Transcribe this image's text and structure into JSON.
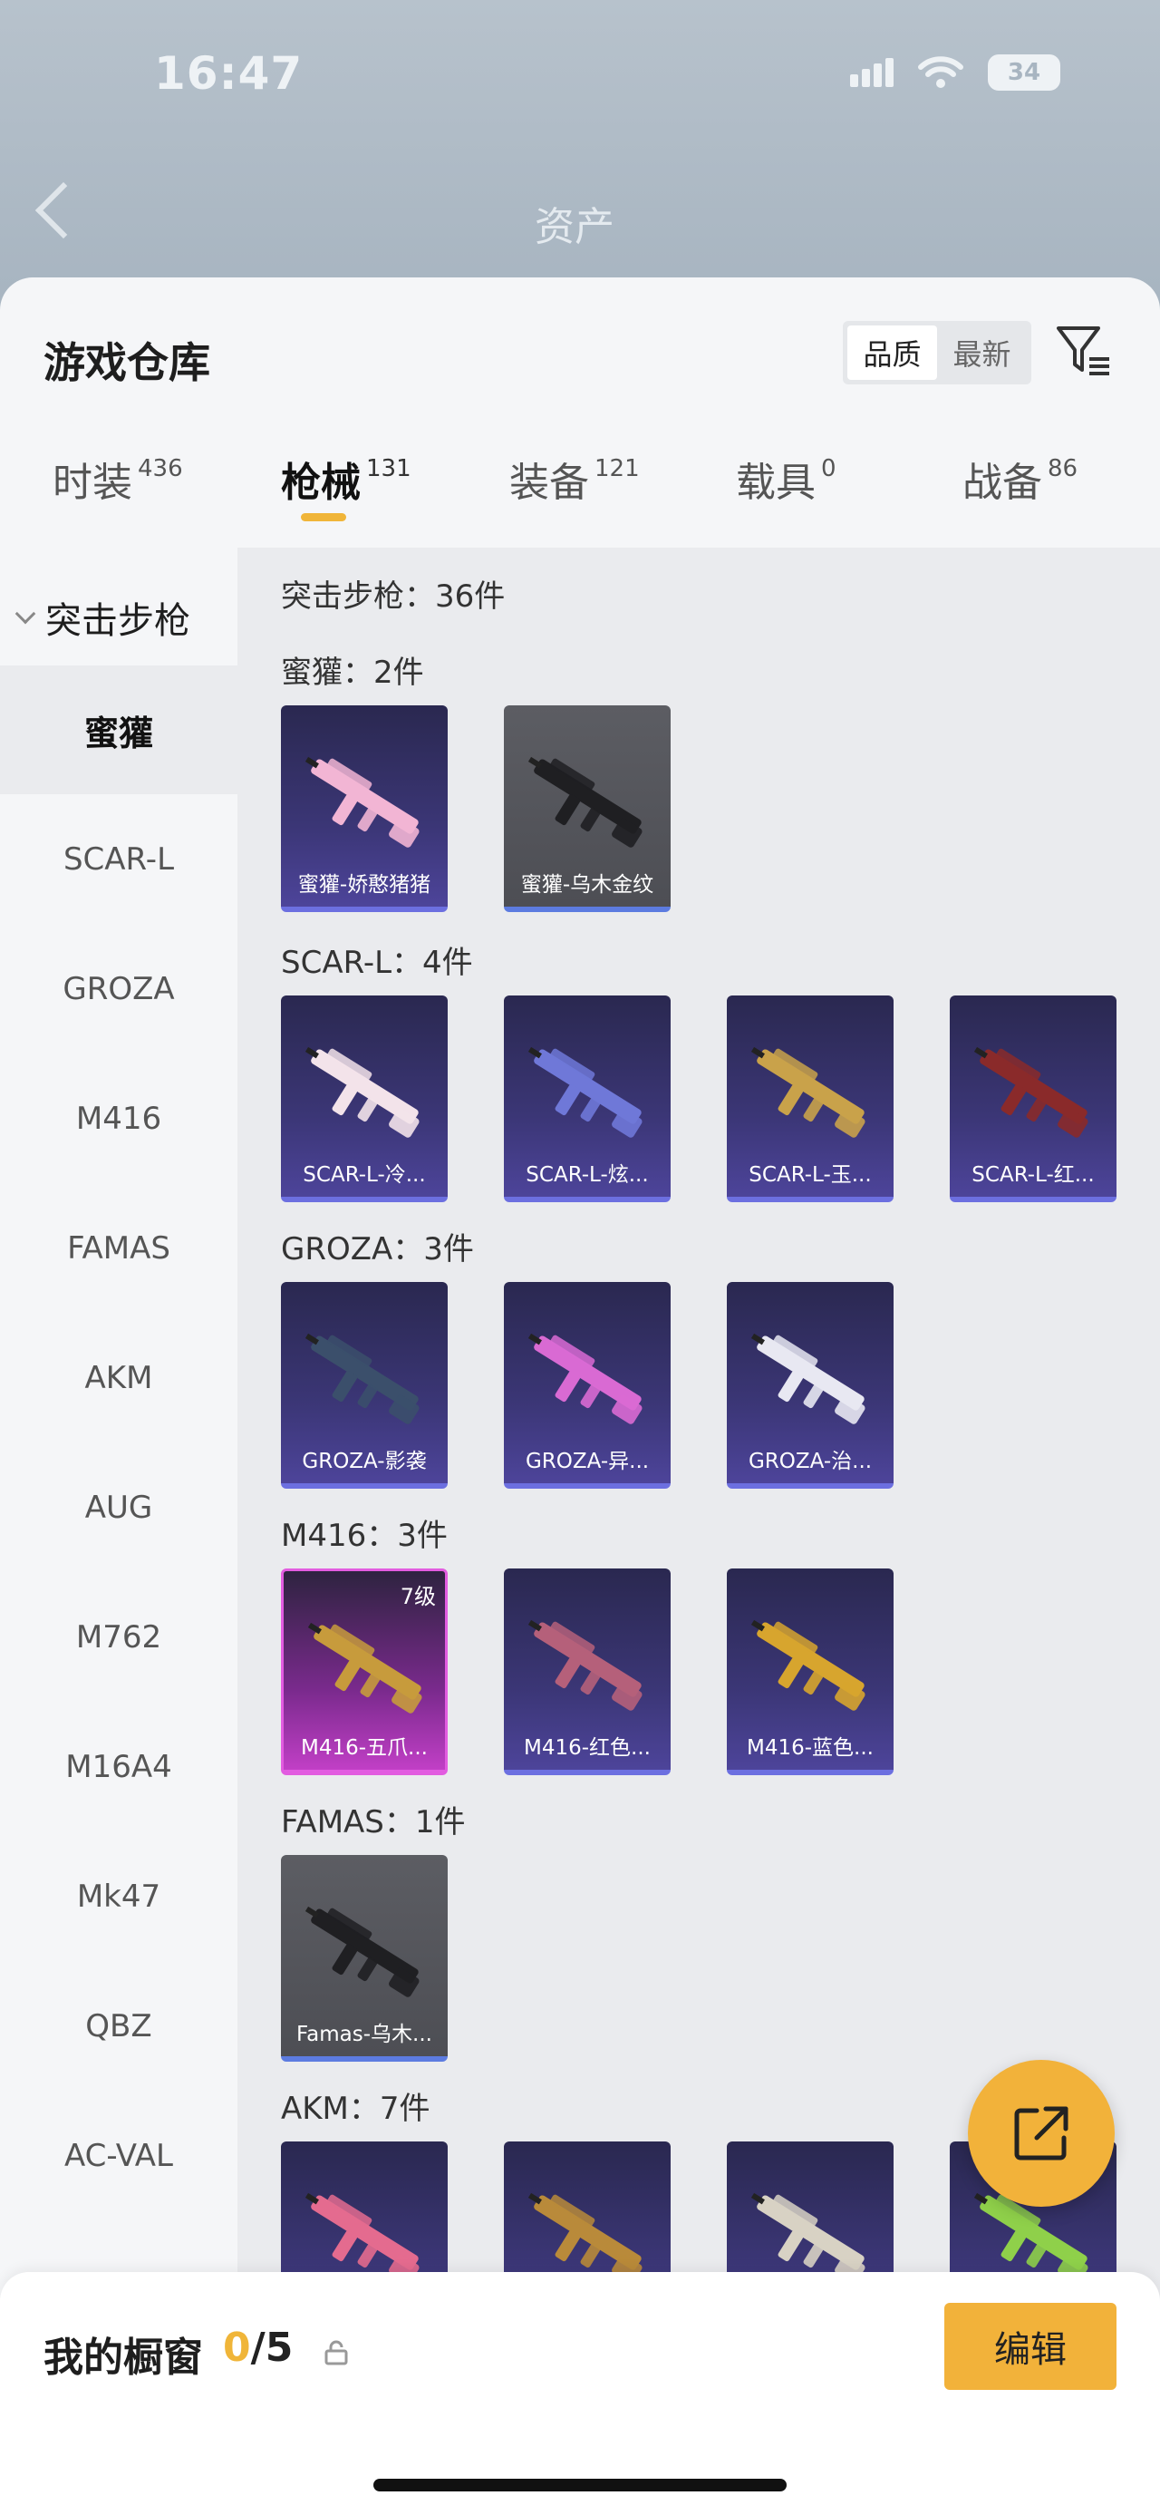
{
  "status_bar": {
    "time": "16:47",
    "battery": "34"
  },
  "nav": {
    "title": "资产"
  },
  "sheet": {
    "title": "游戏仓库",
    "sort_options": [
      "品质",
      "最新"
    ],
    "sort_active": "品质"
  },
  "tabs": [
    {
      "label": "时装",
      "count": "436"
    },
    {
      "label": "枪械",
      "count": "131"
    },
    {
      "label": "装备",
      "count": "121"
    },
    {
      "label": "载具",
      "count": "0"
    },
    {
      "label": "战备",
      "count": "86"
    }
  ],
  "sidebar": {
    "heading": "突击步枪",
    "items": [
      "蜜獾",
      "SCAR-L",
      "GROZA",
      "M416",
      "FAMAS",
      "AKM",
      "AUG",
      "M762",
      "M16A4",
      "Mk47",
      "QBZ",
      "AC-VAL"
    ],
    "active": "蜜獾"
  },
  "content": {
    "summary": "突击步枪：36件",
    "groups": [
      {
        "label": "蜜獾：2件",
        "items": [
          {
            "name": "蜜獾-娇憨猪猪",
            "style": "purple",
            "gun_color": "#f2b5d4"
          },
          {
            "name": "蜜獾-乌木金纹",
            "style": "grey",
            "gun_color": "#1f1f22"
          }
        ]
      },
      {
        "label": "SCAR-L：4件",
        "items": [
          {
            "name": "SCAR-L-冷...",
            "style": "purple",
            "gun_color": "#f3e3ea"
          },
          {
            "name": "SCAR-L-炫...",
            "style": "purple",
            "gun_color": "#6f78d8"
          },
          {
            "name": "SCAR-L-玉...",
            "style": "purple",
            "gun_color": "#c9a24a"
          },
          {
            "name": "SCAR-L-红...",
            "style": "purple",
            "gun_color": "#8a2a2a"
          }
        ]
      },
      {
        "label": "GROZA：3件",
        "items": [
          {
            "name": "GROZA-影袭",
            "style": "purple",
            "gun_color": "#3b4f6b"
          },
          {
            "name": "GROZA-异...",
            "style": "purple",
            "gun_color": "#d96ad3"
          },
          {
            "name": "GROZA-治...",
            "style": "purple",
            "gun_color": "#e8e8f2"
          }
        ]
      },
      {
        "label": "M416：3件",
        "items": [
          {
            "name": "M416-五爪...",
            "style": "pink",
            "gun_color": "#c79b3c",
            "level": "7级"
          },
          {
            "name": "M416-红色...",
            "style": "purple",
            "gun_color": "#b5607a"
          },
          {
            "name": "M416-蓝色...",
            "style": "purple",
            "gun_color": "#d7a52e"
          }
        ]
      },
      {
        "label": "FAMAS：1件",
        "items": [
          {
            "name": "Famas-乌木...",
            "style": "grey",
            "gun_color": "#1f1f22"
          }
        ]
      },
      {
        "label": "AKM：7件",
        "items": [
          {
            "name": "",
            "style": "purple",
            "gun_color": "#e46b8f"
          },
          {
            "name": "",
            "style": "purple",
            "gun_color": "#b98a3a"
          },
          {
            "name": "",
            "style": "purple",
            "gun_color": "#d8d2c4"
          },
          {
            "name": "",
            "style": "purple",
            "gun_color": "#8fd04a"
          }
        ]
      }
    ]
  },
  "bottom_bar": {
    "showcase_label": "我的橱窗",
    "showcase_current": "0",
    "showcase_total": "/5",
    "edit_label": "编辑"
  },
  "colors": {
    "accent": "#f2b23a",
    "rare_purple": "#3b3676",
    "legendary_pink": "#c13fc6"
  }
}
